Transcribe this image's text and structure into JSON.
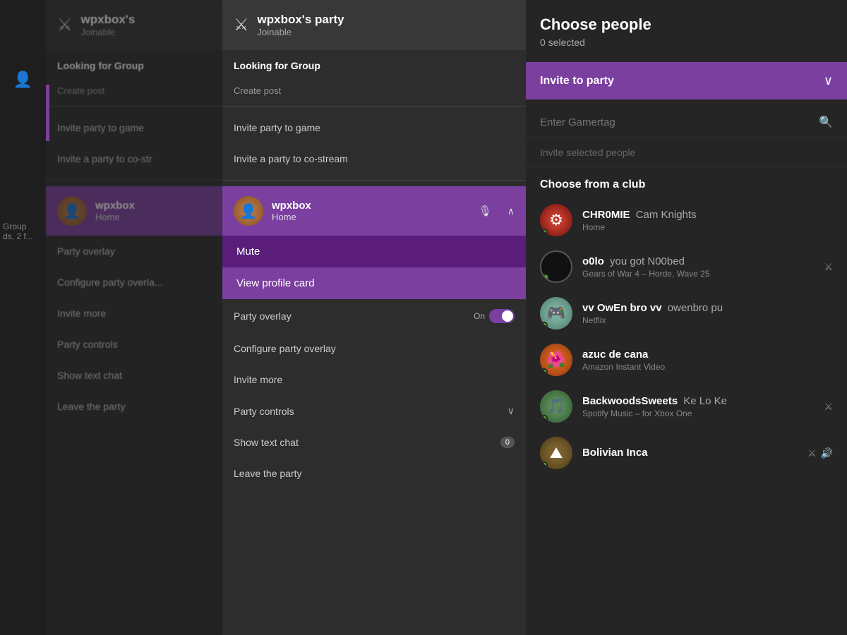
{
  "leftNav": {
    "items": [
      {
        "icon": "👤",
        "name": "player-icon",
        "active": true
      }
    ]
  },
  "panel1": {
    "header": {
      "icon": "⚔",
      "title": "wpxbox's",
      "subtitle": "Joinable"
    },
    "menuItems": [
      {
        "label": "Looking for Group",
        "type": "bold"
      },
      {
        "label": "Create post",
        "type": "sub"
      },
      {
        "label": "Invite party to game",
        "type": "normal"
      },
      {
        "label": "Invite a party to co-str",
        "type": "normal"
      }
    ],
    "userCard": {
      "name": "wpxbox",
      "status": "Home"
    },
    "bottomItems": [
      {
        "label": "Party overlay"
      },
      {
        "label": "Configure party overla..."
      },
      {
        "label": "Invite more"
      },
      {
        "label": "Party controls"
      },
      {
        "label": "Show text chat"
      },
      {
        "label": "Leave the party"
      }
    ],
    "groupInfo": {
      "line1": "Group",
      "line2": "ds, 2 f..."
    }
  },
  "panel2": {
    "header": {
      "icon": "⚔",
      "title": "wpxbox's party",
      "subtitle": "Joinable"
    },
    "menuItems": [
      {
        "label": "Looking for Group",
        "type": "bold"
      },
      {
        "label": "Create post",
        "type": "sub"
      },
      {
        "label": "Invite party to game",
        "type": "normal"
      },
      {
        "label": "Invite a party to co-stream",
        "type": "normal"
      }
    ],
    "userCard": {
      "name": "wpxbox",
      "status": "Home"
    },
    "contextMenu": [
      {
        "label": "Mute"
      },
      {
        "label": "View profile card"
      }
    ],
    "bottomItems": [
      {
        "label": "Party overlay",
        "toggle": true,
        "toggleState": "On"
      },
      {
        "label": "Configure party overlay"
      },
      {
        "label": "Invite more"
      },
      {
        "label": "Party controls",
        "hasChevron": true
      },
      {
        "label": "Show text chat",
        "badge": "0"
      },
      {
        "label": "Leave the party"
      }
    ]
  },
  "rightPanel": {
    "title": "Choose people",
    "subtitle": "0 selected",
    "inviteDropdown": {
      "label": "Invite to party"
    },
    "gamertagPlaceholder": "Enter Gamertag",
    "inviteSelectedLabel": "Invite selected people",
    "chooseFromClub": "Choose from a club",
    "friends": [
      {
        "name": "CHR0MIE",
        "gamertag": "Cam Knights",
        "detail": "Home",
        "avatarClass": "av-red",
        "avatarText": "",
        "online": true,
        "icons": []
      },
      {
        "name": "o0lo",
        "gamertag": "you got N00bed",
        "detail": "Gears of War 4 – Horde, Wave 25",
        "avatarClass": "av-dark",
        "avatarText": "",
        "online": true,
        "icons": [
          "⚔"
        ]
      },
      {
        "name": "vv OwEn bro vv",
        "gamertag": "owenbro pu",
        "detail": "Netflix",
        "avatarClass": "av-green",
        "avatarText": "",
        "online": true,
        "icons": []
      },
      {
        "name": "azuc de cana",
        "gamertag": "",
        "detail": "Amazon Instant Video",
        "avatarClass": "av-orange",
        "avatarText": "",
        "online": true,
        "icons": []
      },
      {
        "name": "BackwoodsSweets",
        "gamertag": "Ke Lo Ke",
        "detail": "Spotify Music – for Xbox One",
        "avatarClass": "av-blue",
        "avatarText": "",
        "online": true,
        "icons": [
          "⚔"
        ]
      },
      {
        "name": "Bolivian Inca",
        "gamertag": "",
        "detail": "",
        "avatarClass": "av-brown",
        "avatarText": "",
        "online": true,
        "icons": [
          "⚔",
          "🔊"
        ]
      }
    ]
  }
}
